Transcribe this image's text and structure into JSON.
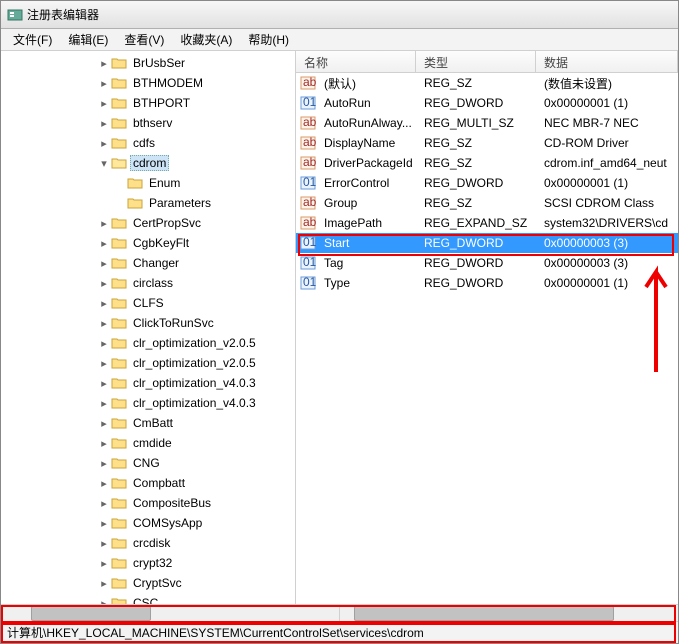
{
  "window": {
    "title": "注册表编辑器"
  },
  "menu": {
    "file": "文件(F)",
    "edit": "编辑(E)",
    "view": "查看(V)",
    "fav": "收藏夹(A)",
    "help": "帮助(H)"
  },
  "tree": {
    "items": [
      {
        "name": "BrUsbSer",
        "indent": 6
      },
      {
        "name": "BTHMODEM",
        "indent": 6
      },
      {
        "name": "BTHPORT",
        "indent": 6
      },
      {
        "name": "bthserv",
        "indent": 6
      },
      {
        "name": "cdfs",
        "indent": 6
      },
      {
        "name": "cdrom",
        "indent": 6,
        "expanded": true,
        "selected": true
      },
      {
        "name": "Enum",
        "indent": 7,
        "noexp": true
      },
      {
        "name": "Parameters",
        "indent": 7,
        "noexp": true
      },
      {
        "name": "CertPropSvc",
        "indent": 6
      },
      {
        "name": "CgbKeyFlt",
        "indent": 6
      },
      {
        "name": "Changer",
        "indent": 6
      },
      {
        "name": "circlass",
        "indent": 6
      },
      {
        "name": "CLFS",
        "indent": 6
      },
      {
        "name": "ClickToRunSvc",
        "indent": 6
      },
      {
        "name": "clr_optimization_v2.0.5",
        "indent": 6
      },
      {
        "name": "clr_optimization_v2.0.5",
        "indent": 6
      },
      {
        "name": "clr_optimization_v4.0.3",
        "indent": 6
      },
      {
        "name": "clr_optimization_v4.0.3",
        "indent": 6
      },
      {
        "name": "CmBatt",
        "indent": 6
      },
      {
        "name": "cmdide",
        "indent": 6
      },
      {
        "name": "CNG",
        "indent": 6
      },
      {
        "name": "Compbatt",
        "indent": 6
      },
      {
        "name": "CompositeBus",
        "indent": 6
      },
      {
        "name": "COMSysApp",
        "indent": 6
      },
      {
        "name": "crcdisk",
        "indent": 6
      },
      {
        "name": "crypt32",
        "indent": 6
      },
      {
        "name": "CryptSvc",
        "indent": 6
      },
      {
        "name": "CSC",
        "indent": 6
      }
    ]
  },
  "list": {
    "headers": {
      "name": "名称",
      "type": "类型",
      "data": "数据"
    },
    "rows": [
      {
        "icon": "sz",
        "name": "(默认)",
        "type": "REG_SZ",
        "data": "(数值未设置)"
      },
      {
        "icon": "dw",
        "name": "AutoRun",
        "type": "REG_DWORD",
        "data": "0x00000001 (1)"
      },
      {
        "icon": "sz",
        "name": "AutoRunAlway...",
        "type": "REG_MULTI_SZ",
        "data": "NEC   MBR-7   NEC"
      },
      {
        "icon": "sz",
        "name": "DisplayName",
        "type": "REG_SZ",
        "data": "CD-ROM Driver"
      },
      {
        "icon": "sz",
        "name": "DriverPackageId",
        "type": "REG_SZ",
        "data": "cdrom.inf_amd64_neut"
      },
      {
        "icon": "dw",
        "name": "ErrorControl",
        "type": "REG_DWORD",
        "data": "0x00000001 (1)"
      },
      {
        "icon": "sz",
        "name": "Group",
        "type": "REG_SZ",
        "data": "SCSI CDROM Class"
      },
      {
        "icon": "sz",
        "name": "ImagePath",
        "type": "REG_EXPAND_SZ",
        "data": "system32\\DRIVERS\\cd"
      },
      {
        "icon": "dw",
        "name": "Start",
        "type": "REG_DWORD",
        "data": "0x00000003 (3)",
        "selected": true
      },
      {
        "icon": "dw",
        "name": "Tag",
        "type": "REG_DWORD",
        "data": "0x00000003 (3)"
      },
      {
        "icon": "dw",
        "name": "Type",
        "type": "REG_DWORD",
        "data": "0x00000001 (1)"
      }
    ]
  },
  "status": {
    "path": "计算机\\HKEY_LOCAL_MACHINE\\SYSTEM\\CurrentControlSet\\services\\cdrom"
  }
}
